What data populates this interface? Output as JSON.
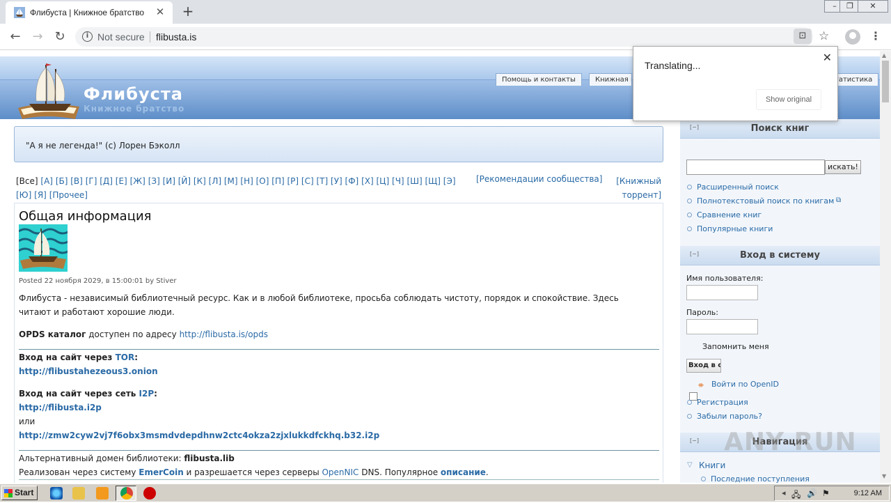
{
  "browser": {
    "tab_title": "Флибуста | Книжное братство",
    "security_label": "Not secure",
    "url": "flibusta.is"
  },
  "translate_popup": {
    "message": "Translating...",
    "show_original": "Show original"
  },
  "site": {
    "name": "Флибуста",
    "slogan": "Книжное братство",
    "primary_tabs": [
      "Помощь и контакты",
      "Книжная п",
      "татистика"
    ]
  },
  "quote": "\"А я не легенда!\" (с) Лорен Бэколл",
  "alphabet": {
    "current": "[Все]",
    "letters": [
      "[А]",
      "[Б]",
      "[В]",
      "[Г]",
      "[Д]",
      "[Е]",
      "[Ж]",
      "[З]",
      "[И]",
      "[Й]",
      "[К]",
      "[Л]",
      "[М]",
      "[Н]",
      "[О]",
      "[П]",
      "[Р]",
      "[С]",
      "[Т]",
      "[У]",
      "[Ф]",
      "[Х]",
      "[Ц]",
      "[Ч]",
      "[Ш]",
      "[Щ]",
      "[Э]",
      "[Ю]",
      "[Я]",
      "[Прочее]"
    ],
    "recommend": "[Рекомендации сообщества]",
    "torrent_line1": "[Книжный",
    "torrent_line2": "торрент]"
  },
  "article": {
    "title": "Общая информация",
    "posted": "Posted 22 ноября 2029, в 15:00:01 by Stiver",
    "intro": "Флибуста - независимый библиотечный ресурс. Как и в любой библиотеке, просьба соблюдать чистоту, порядок и спокойствие. Здесь читают и работают хорошие люди.",
    "opds_label": "OPDS каталог",
    "opds_text": " доступен по адресу ",
    "opds_link": "http://flibusta.is/opds",
    "tor_label": "Вход на сайт через ",
    "tor_word": "TOR",
    "tor_link": "http://flibustahezeous3.onion",
    "i2p_label": "Вход на сайт через сеть ",
    "i2p_word": "I2P",
    "i2p_link1": "http://flibusta.i2p",
    "or": "или",
    "i2p_link2": "http://zmw2cyw2vj7f6obx3msmdvdepdhnw2ctc4okza2zjxlukkdfckhq.b32.i2p",
    "alt_domain_label": "Альтернативный домен библиотеки: ",
    "alt_domain": "flibusta.lib",
    "impl_1": "Реализован через систему ",
    "emercoin": "EmerCoin",
    "impl_2": " и разрешается через серверы ",
    "opennic": "OpenNIC",
    "impl_3": " DNS. Популярное ",
    "description": "описание",
    "impl_4": "."
  },
  "sidebar": {
    "toggle": "[−]",
    "search_title": "Поиск книг",
    "search_button": "искать!",
    "search_links": [
      "Расширенный поиск",
      "Полнотекстовый поиск по книгам",
      "Сравнение книг",
      "Популярные книги"
    ],
    "login_title": "Вход в систему",
    "username_label": "Имя пользователя:",
    "password_label": "Пароль:",
    "remember_label": "Запомнить меня",
    "login_button": "Вход в с",
    "openid_link": "Войти по OpenID",
    "register_link": "Регистрация",
    "forgot_link": "Забыли пароль?",
    "nav_title": "Навигация",
    "nav_books": "Книги",
    "nav_recent": "Последние поступления"
  },
  "watermark": "ANY RUN",
  "taskbar": {
    "start": "Start",
    "clock": "9:12 AM"
  }
}
